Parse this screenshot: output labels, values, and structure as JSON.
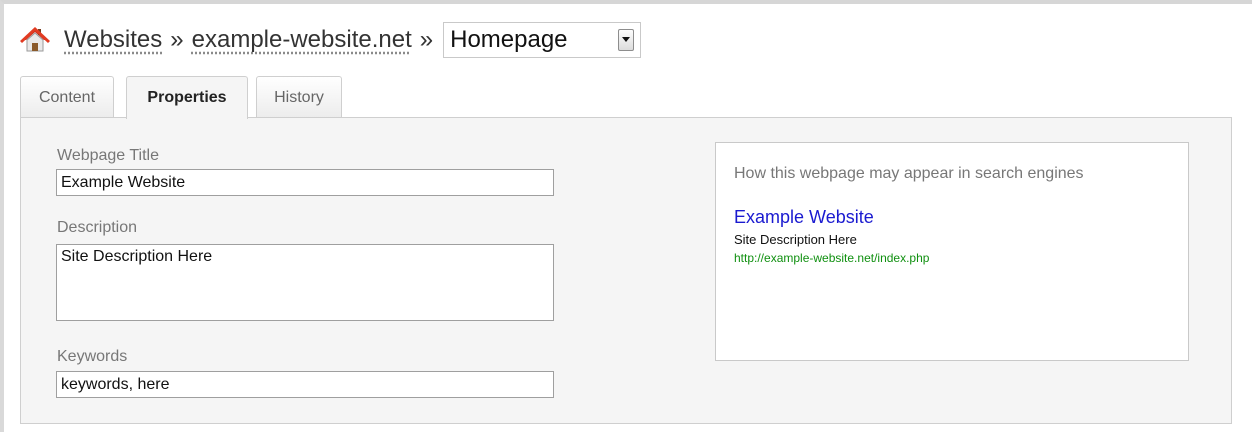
{
  "breadcrumb": {
    "items": [
      "Websites",
      "example-website.net"
    ],
    "separator": "»",
    "page_select": {
      "value": "Homepage"
    }
  },
  "tabs": [
    {
      "label": "Content",
      "active": false
    },
    {
      "label": "Properties",
      "active": true
    },
    {
      "label": "History",
      "active": false
    }
  ],
  "form": {
    "title": {
      "label": "Webpage Title",
      "value": "Example Website"
    },
    "description": {
      "label": "Description",
      "value": "Site Description Here"
    },
    "keywords": {
      "label": "Keywords",
      "value": "keywords, here"
    }
  },
  "preview": {
    "heading": "How this webpage may appear in search engines",
    "title": "Example Website",
    "description": "Site Description Here",
    "url": "http://example-website.net/index.php"
  },
  "colors": {
    "link": "#1a1ad0",
    "url": "#109010",
    "panel_bg": "#f5f5f5"
  },
  "icons": {
    "home": "house-icon",
    "dropdown": "chevron-down-icon"
  }
}
